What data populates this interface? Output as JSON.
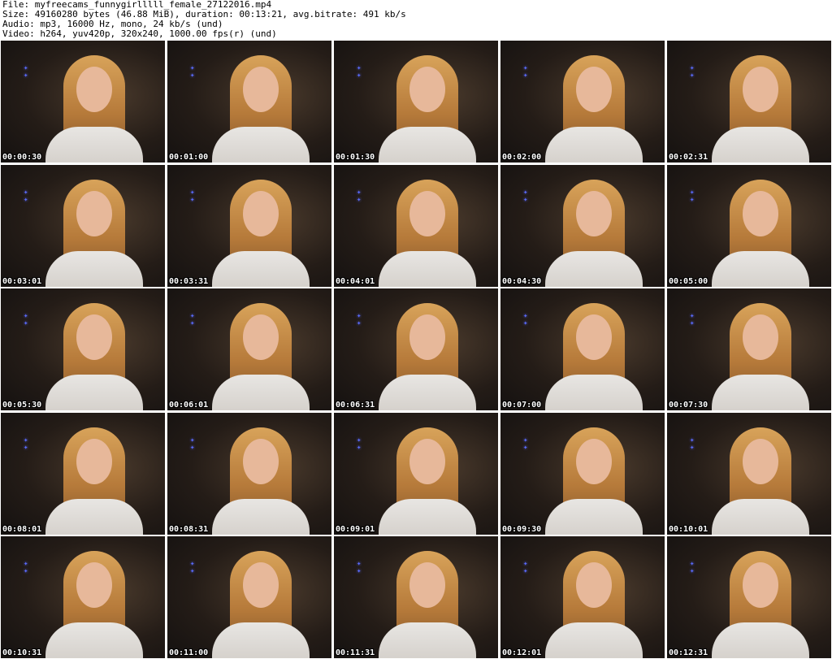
{
  "header": {
    "file": "File: myfreecams_funnygirlllll_female_27122016.mp4",
    "size": "Size: 49160280 bytes (46.88 MiB), duration: 00:13:21, avg.bitrate: 491 kb/s",
    "audio": "Audio: mp3, 16000 Hz, mono, 24 kb/s (und)",
    "video": "Video: h264, yuv420p, 320x240, 1000.00 fps(r) (und)"
  },
  "thumbnails": [
    {
      "time": "00:00:30"
    },
    {
      "time": "00:01:00"
    },
    {
      "time": "00:01:30"
    },
    {
      "time": "00:02:00"
    },
    {
      "time": "00:02:31"
    },
    {
      "time": "00:03:01"
    },
    {
      "time": "00:03:31"
    },
    {
      "time": "00:04:01"
    },
    {
      "time": "00:04:30"
    },
    {
      "time": "00:05:00"
    },
    {
      "time": "00:05:30"
    },
    {
      "time": "00:06:01"
    },
    {
      "time": "00:06:31"
    },
    {
      "time": "00:07:00"
    },
    {
      "time": "00:07:30"
    },
    {
      "time": "00:08:01"
    },
    {
      "time": "00:08:31"
    },
    {
      "time": "00:09:01"
    },
    {
      "time": "00:09:30"
    },
    {
      "time": "00:10:01"
    },
    {
      "time": "00:10:31"
    },
    {
      "time": "00:11:00"
    },
    {
      "time": "00:11:31"
    },
    {
      "time": "00:12:01"
    },
    {
      "time": "00:12:31"
    }
  ]
}
